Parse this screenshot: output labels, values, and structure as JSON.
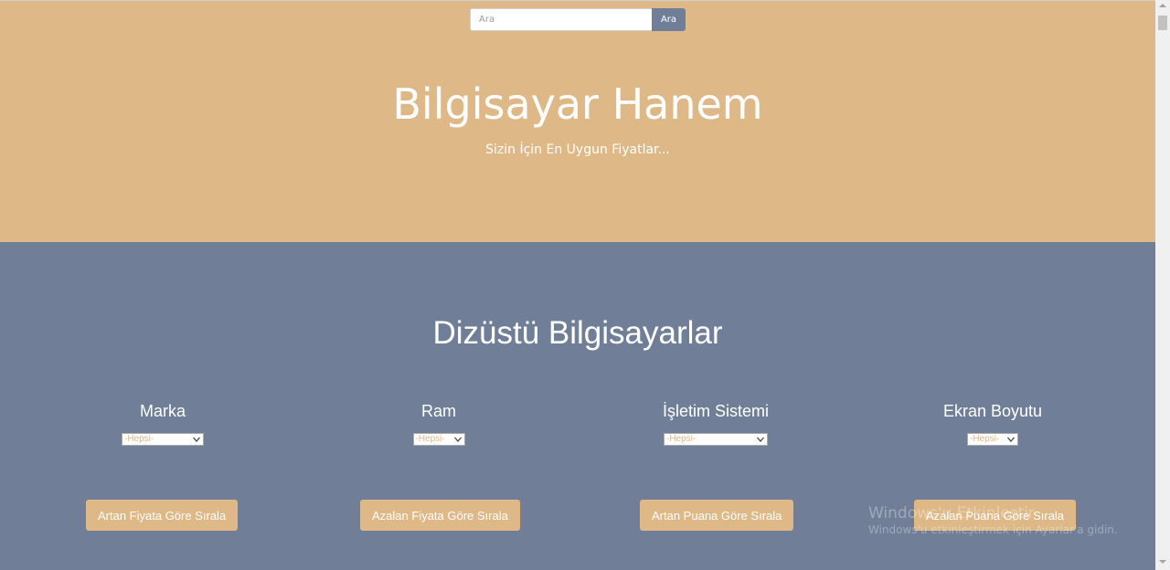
{
  "search": {
    "placeholder": "Ara",
    "button_label": "Ara"
  },
  "hero": {
    "title": "Bilgisayar Hanem",
    "subtitle": "Sizin İçin En Uygun Fiyatlar..."
  },
  "section": {
    "title": "Dizüstü Bilgisayarlar",
    "filters": [
      {
        "label": "Marka",
        "selected": "-Hepsi-"
      },
      {
        "label": "Ram",
        "selected": "-Hepsi-"
      },
      {
        "label": "İşletim Sistemi",
        "selected": "-Hepsi-"
      },
      {
        "label": "Ekran Boyutu",
        "selected": "-Hepsi-"
      }
    ],
    "sort_buttons": [
      "Artan Fiyata Göre Sırala",
      "Azalan Fiyata Göre Sırala",
      "Artan Puana Göre Sırala",
      "Azalan Puana Göre Sırala"
    ]
  },
  "watermark": {
    "title": "Windows'u Etkinleştir",
    "text": "Windows'u etkinleştirmek için Ayarlar'a gidin."
  },
  "colors": {
    "tan": "#dfb887",
    "slate": "#707f97",
    "white": "#ffffff"
  }
}
